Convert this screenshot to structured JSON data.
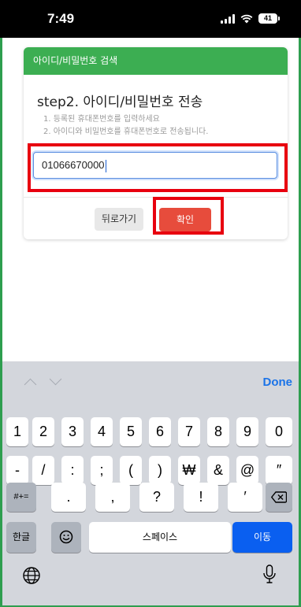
{
  "status_bar": {
    "time": "7:49",
    "battery": "41"
  },
  "card": {
    "header": "아이디/비밀번호 검색",
    "title": "step2. 아이디/비밀번호 전송",
    "instructions": [
      "1.  등록된 휴대폰번호를 입력하세요",
      "2.  아이디와 비밀번호를 휴대폰번호로 전송됩니다."
    ],
    "phone_value": "01066670000",
    "back_label": "뒤로가기",
    "confirm_label": "확인"
  },
  "keyboard": {
    "done_label": "Done",
    "row1": [
      "1",
      "2",
      "3",
      "4",
      "5",
      "6",
      "7",
      "8",
      "9",
      "0"
    ],
    "row2": [
      "-",
      "/",
      ":",
      ";",
      "(",
      ")",
      "₩",
      "&",
      "@",
      "″"
    ],
    "row3": [
      "#+=",
      ".",
      ",",
      "?",
      "!",
      "′"
    ],
    "korean_label": "한글",
    "space_label": "스페이스",
    "return_label": "이동"
  },
  "colors": {
    "header_green": "#3cae52",
    "confirm_red": "#e74c3c",
    "highlight_red": "#e8000f",
    "done_blue": "#1a73e8",
    "return_blue": "#0a5ff0"
  }
}
